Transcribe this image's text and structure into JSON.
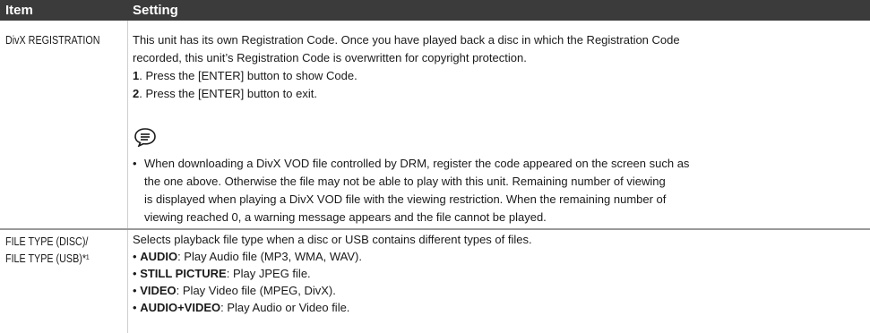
{
  "header": {
    "item": "Item",
    "setting": "Setting"
  },
  "rows": [
    {
      "item": "DivX REGISTRATION",
      "lines": [
        "This unit has its own Registration Code. Once you have played back a disc in which the Registration Code",
        "recorded, this unit’s Registration Code is overwritten for copyright protection."
      ],
      "steps": [
        {
          "num": "1",
          "text": ". Press the [ENTER] button to show Code."
        },
        {
          "num": "2",
          "text": ". Press the [ENTER] button to exit."
        }
      ],
      "note_icon": "note-speech-bubble-icon",
      "note": {
        "bullet": "•",
        "first": "When downloading a DivX VOD file controlled by DRM, register the code appeared on the screen such as",
        "rest": [
          "the one above. Otherwise the file may not be able to play with this unit. Remaining number of viewing",
          "is displayed when playing a DivX VOD file with the viewing restriction. When the remaining number of",
          "viewing reached 0, a warning message appears and the file cannot be played."
        ]
      }
    },
    {
      "item_lines": [
        "FILE TYPE (DISC)/",
        "FILE TYPE (USB)*¹"
      ],
      "intro": "Selects playback file type when a disc or USB contains different types of files.",
      "options": [
        {
          "bullet": "•",
          "label": "AUDIO",
          "desc": ": Play Audio file (MP3, WMA, WAV)."
        },
        {
          "bullet": "•",
          "label": "STILL PICTURE",
          "desc": ": Play JPEG file."
        },
        {
          "bullet": "•",
          "label": "VIDEO",
          "desc": ": Play Video file (MPEG, DivX)."
        },
        {
          "bullet": "•",
          "label": "AUDIO+VIDEO",
          "desc": ": Play Audio or Video file."
        }
      ]
    }
  ]
}
